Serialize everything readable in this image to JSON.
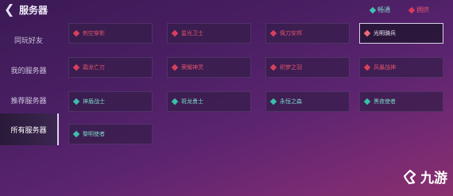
{
  "header": {
    "title": "服务器",
    "legend": [
      {
        "label": "畅通",
        "color": "#3ec2b0"
      },
      {
        "label": "拥挤",
        "color": "#d93a5a"
      }
    ]
  },
  "sidebar": {
    "tabs": [
      {
        "label": "同玩好友",
        "active": false
      },
      {
        "label": "我的服务器",
        "active": false
      },
      {
        "label": "推荐服务器",
        "active": false
      },
      {
        "label": "所有服务器",
        "active": true
      }
    ]
  },
  "servers": [
    {
      "name": "刺空穿影",
      "status": "red"
    },
    {
      "name": "星光卫士",
      "status": "red"
    },
    {
      "name": "佩刀安邦",
      "status": "red"
    },
    {
      "name": "光明骑兵",
      "status": "red",
      "selected": true
    },
    {
      "name": "霜龙亡刃",
      "status": "red"
    },
    {
      "name": "荣耀神灵",
      "status": "red"
    },
    {
      "name": "织梦之羽",
      "status": "red"
    },
    {
      "name": "风暴战神",
      "status": "red"
    },
    {
      "name": "神盾战士",
      "status": "green"
    },
    {
      "name": "斑龙勇士",
      "status": "green"
    },
    {
      "name": "永恒之森",
      "status": "green"
    },
    {
      "name": "黑夜使者",
      "status": "green"
    },
    {
      "name": "黎明使者",
      "status": "green"
    }
  ],
  "watermark": {
    "text": "九游"
  }
}
